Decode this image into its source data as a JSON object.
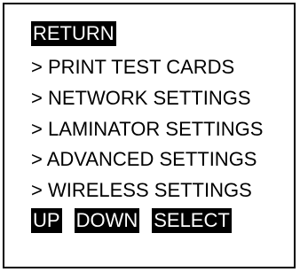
{
  "screen": {
    "return_label": "RETURN",
    "menu_items": [
      {
        "label": "> PRINT TEST CARDS"
      },
      {
        "label": "> NETWORK SETTINGS"
      },
      {
        "label": "> LAMINATOR SETTINGS"
      },
      {
        "label": "> ADVANCED SETTINGS"
      },
      {
        "label": "> WIRELESS SETTINGS"
      }
    ],
    "soft_keys": {
      "up": "UP",
      "down": "DOWN",
      "select": "SELECT"
    }
  },
  "colors": {
    "foreground": "#000000",
    "background": "#ffffff"
  }
}
